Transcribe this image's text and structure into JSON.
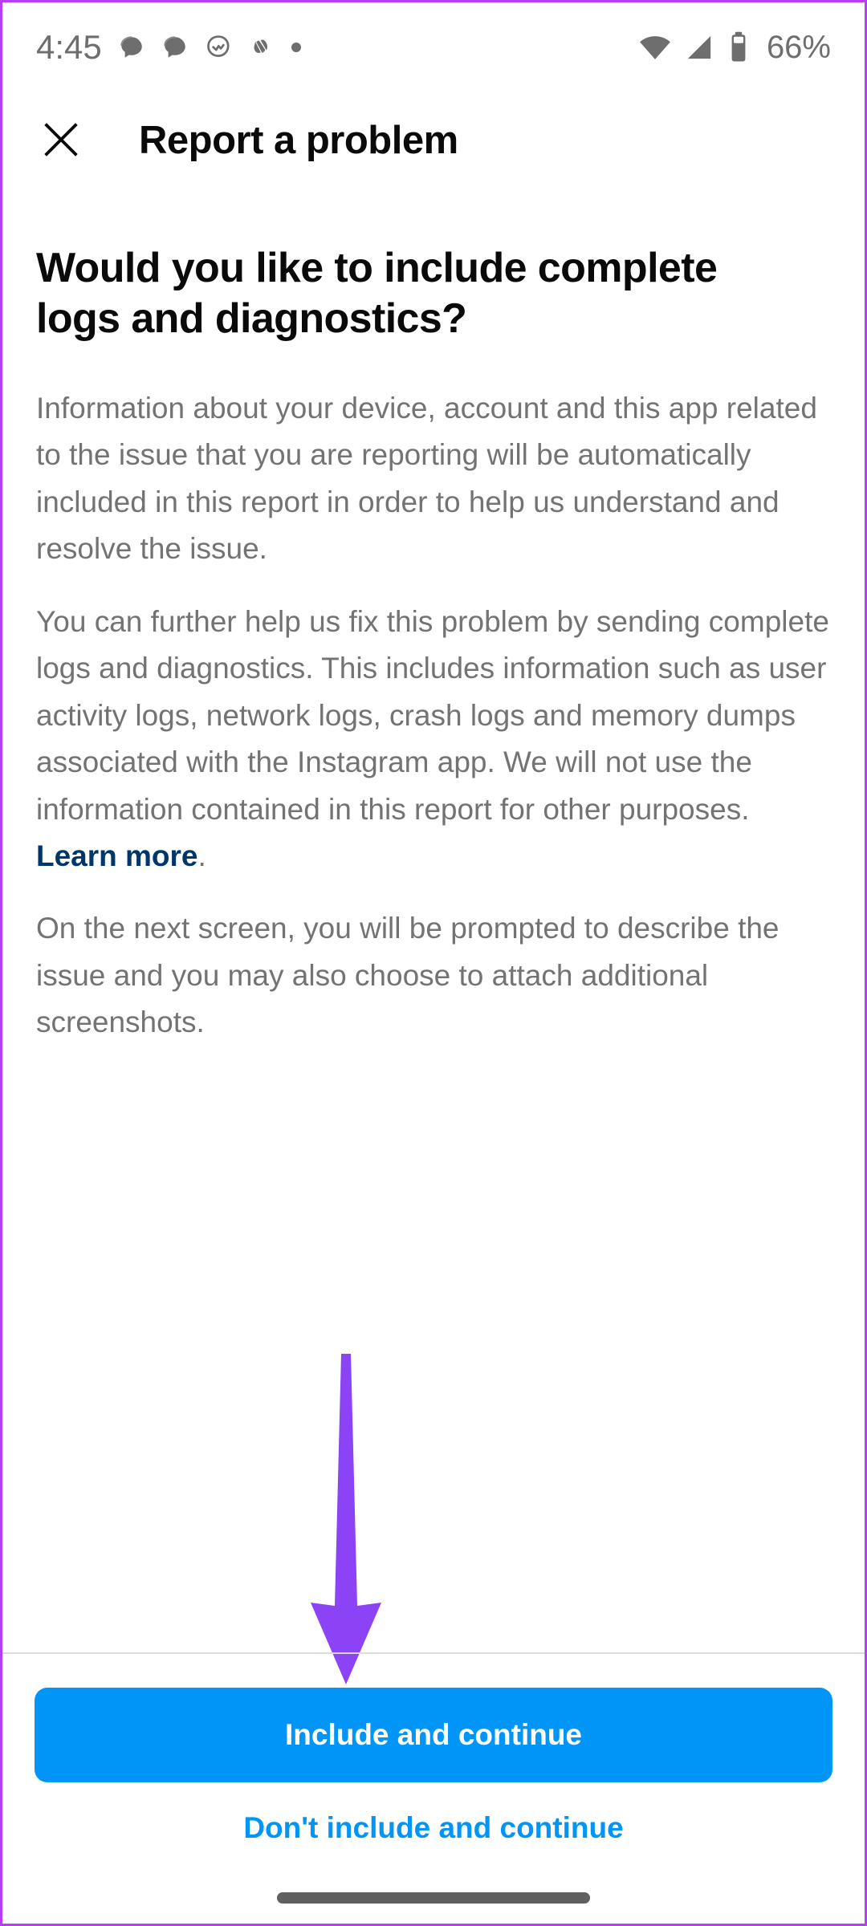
{
  "status_bar": {
    "clock": "4:45",
    "battery_percent": "66%",
    "left_icons": [
      "chat-bubble-icon",
      "chat-bubble-icon",
      "threads-activity-icon",
      "swoosh-app-icon",
      "notification-dot-icon"
    ],
    "right_icons": [
      "wifi-icon",
      "cellular-signal-icon",
      "battery-icon"
    ],
    "icon_color": "#6e6e6e"
  },
  "header": {
    "close_icon": "close-x-icon",
    "title": "Report a problem"
  },
  "content": {
    "heading": "Would you like to include complete logs and diagnostics?",
    "paragraph_1": "Information about your device, account and this app related to the issue that you are reporting will be automatically included in this report in order to help us understand and resolve the issue.",
    "paragraph_2_before_link": "You can further help us fix this problem by sending complete logs and diagnostics. This includes information such as user activity logs, network logs, crash logs and memory dumps associated with the Instagram app. We will not use the information contained in this report for other purposes. ",
    "learn_more_link": "Learn more",
    "paragraph_2_after_link": ".",
    "paragraph_3": "On the next screen, you will be prompted to describe the issue and you may also choose to attach additional screenshots."
  },
  "annotation": {
    "arrow_icon": "down-arrow-annotation-icon",
    "color": "#8c42f5",
    "points_to": "include-and-continue-button"
  },
  "footer": {
    "primary_button": "Include and continue",
    "secondary_button": "Don't include and continue",
    "primary_color": "#0095f6",
    "secondary_text_color": "#0095f6"
  },
  "system_nav": {
    "home_indicator": "home-indicator-pill"
  },
  "colors": {
    "background": "#ffffff",
    "body_text": "#737373",
    "heading_text": "#0a0a0a",
    "link_dark_blue": "#00376b",
    "accent_blue": "#0095f6",
    "divider": "#dbdbdb",
    "annotation_purple": "#8c42f5",
    "screenshot_border": "#b83df5"
  }
}
